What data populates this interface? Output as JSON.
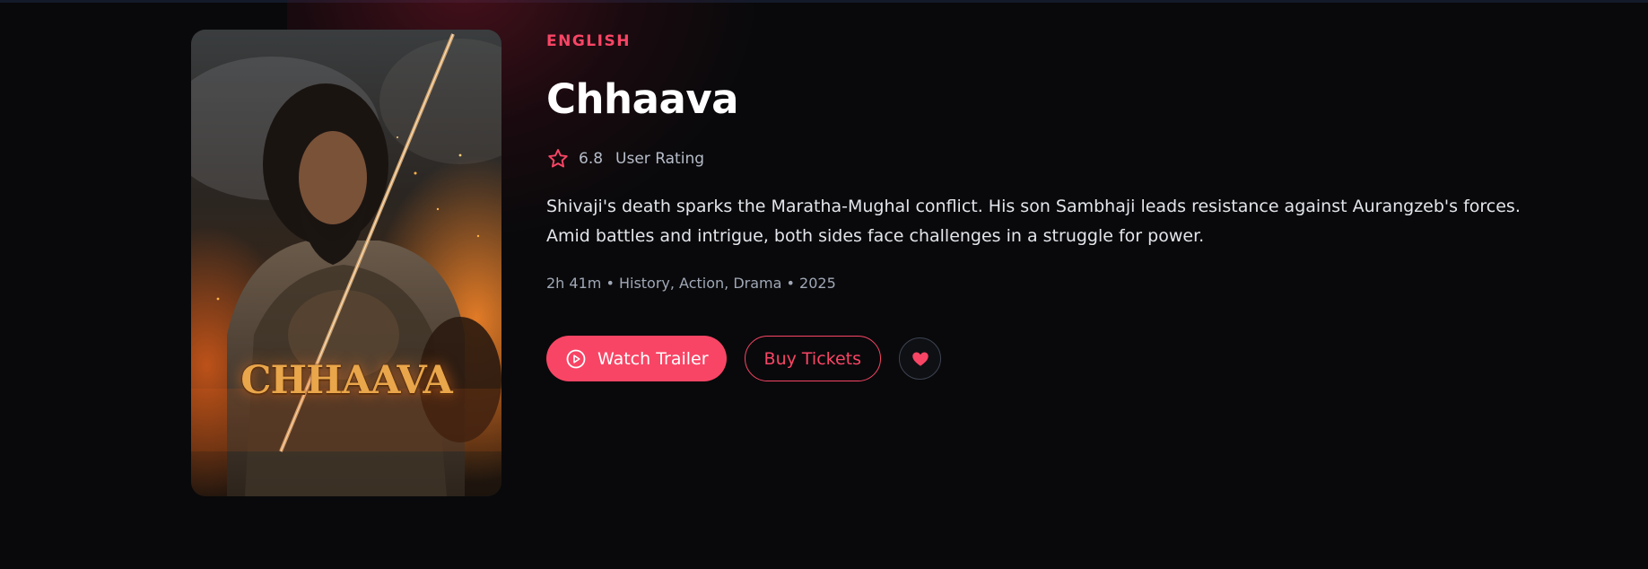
{
  "movie": {
    "language": "ENGLISH",
    "title": "Chhaava",
    "rating": "6.8",
    "rating_label": "User Rating",
    "description_lines": [
      "Shivaji's death sparks the Maratha-Mughal conflict. His son Sambhaji leads resistance against Aurangzeb's forces.",
      "Amid battles and intrigue, both sides face challenges in a struggle for power."
    ],
    "meta": "2h 41m • History, Action, Drama • 2025",
    "poster_title": "CHHAAVA"
  },
  "actions": {
    "watch_trailer_label": "Watch Trailer",
    "buy_tickets_label": "Buy Tickets"
  },
  "icons": {
    "rating": "star-icon",
    "trailer": "play-circle-icon",
    "favorite": "heart-icon"
  },
  "colors": {
    "accent": "#f84565",
    "background": "#09090b",
    "muted_text": "#a0a8b6"
  }
}
